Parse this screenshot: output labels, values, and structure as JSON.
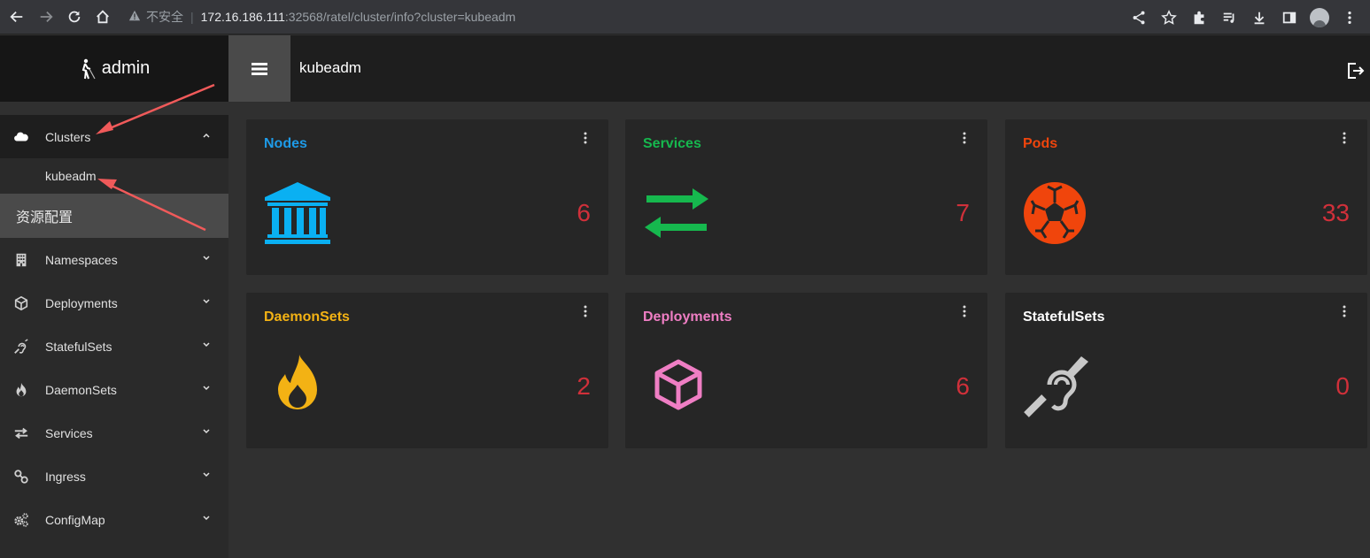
{
  "browser": {
    "security_label": "不安全",
    "url_host": "172.16.186.111",
    "url_path": ":32568/ratel/cluster/info?cluster=kubeadm"
  },
  "sidebar": {
    "user": "admin",
    "clusters_label": "Clusters",
    "cluster_sub_item": "kubeadm",
    "section_label": "资源配置",
    "items": [
      {
        "label": "Namespaces",
        "icon": "building-icon"
      },
      {
        "label": "Deployments",
        "icon": "cube-icon"
      },
      {
        "label": "StatefulSets",
        "icon": "hearing-icon"
      },
      {
        "label": "DaemonSets",
        "icon": "fire-icon"
      },
      {
        "label": "Services",
        "icon": "exchange-icon"
      },
      {
        "label": "Ingress",
        "icon": "link-icon"
      },
      {
        "label": "ConfigMap",
        "icon": "gears-icon"
      }
    ]
  },
  "header": {
    "cluster_name": "kubeadm"
  },
  "cards": [
    {
      "title": "Nodes",
      "count": "6",
      "color": "#1e9be8",
      "icon": "bank-icon"
    },
    {
      "title": "Services",
      "count": "7",
      "color": "#16b84e",
      "icon": "exchange-icon"
    },
    {
      "title": "Pods",
      "count": "33",
      "color": "#f0450c",
      "icon": "soccer-ball-icon"
    },
    {
      "title": "DaemonSets",
      "count": "2",
      "color": "#f3b214",
      "icon": "fire-icon"
    },
    {
      "title": "Deployments",
      "count": "6",
      "color": "#ef7ec4",
      "icon": "cube-icon"
    },
    {
      "title": "StatefulSets",
      "count": "0",
      "color": "#ffffff",
      "icon": "hearing-icon"
    }
  ],
  "colors": {
    "count_color": "#d0303a",
    "arrow_color": "#f05a5a"
  }
}
